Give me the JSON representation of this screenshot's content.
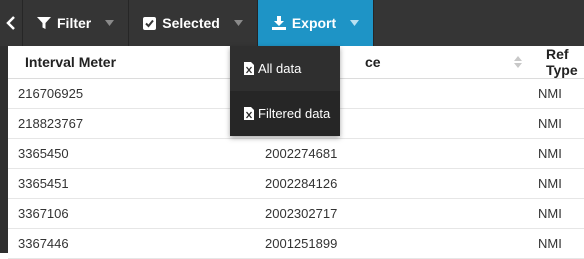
{
  "toolbar": {
    "filter_label": "Filter",
    "selected_label": "Selected",
    "export_label": "Export"
  },
  "export_menu": {
    "items": [
      {
        "label": "All data",
        "icon": "excel-file-icon"
      },
      {
        "label": "Filtered data",
        "icon": "excel-file-icon"
      }
    ]
  },
  "table": {
    "headers": [
      "Interval Meter",
      "ce",
      "Ref Type"
    ],
    "rows": [
      [
        "216706925",
        "",
        "NMI"
      ],
      [
        "218823767",
        "",
        "NMI"
      ],
      [
        "3365450",
        "2002274681",
        "NMI"
      ],
      [
        "3365451",
        "2002284126",
        "NMI"
      ],
      [
        "3367106",
        "2002302717",
        "NMI"
      ],
      [
        "3367446",
        "2001251899",
        "NMI"
      ]
    ]
  },
  "colors": {
    "toolbar_bg": "#353535",
    "export_active": "#1e94c6",
    "dropdown_bg": "#2f2f2f",
    "sort_accent": "#1e94c6"
  }
}
